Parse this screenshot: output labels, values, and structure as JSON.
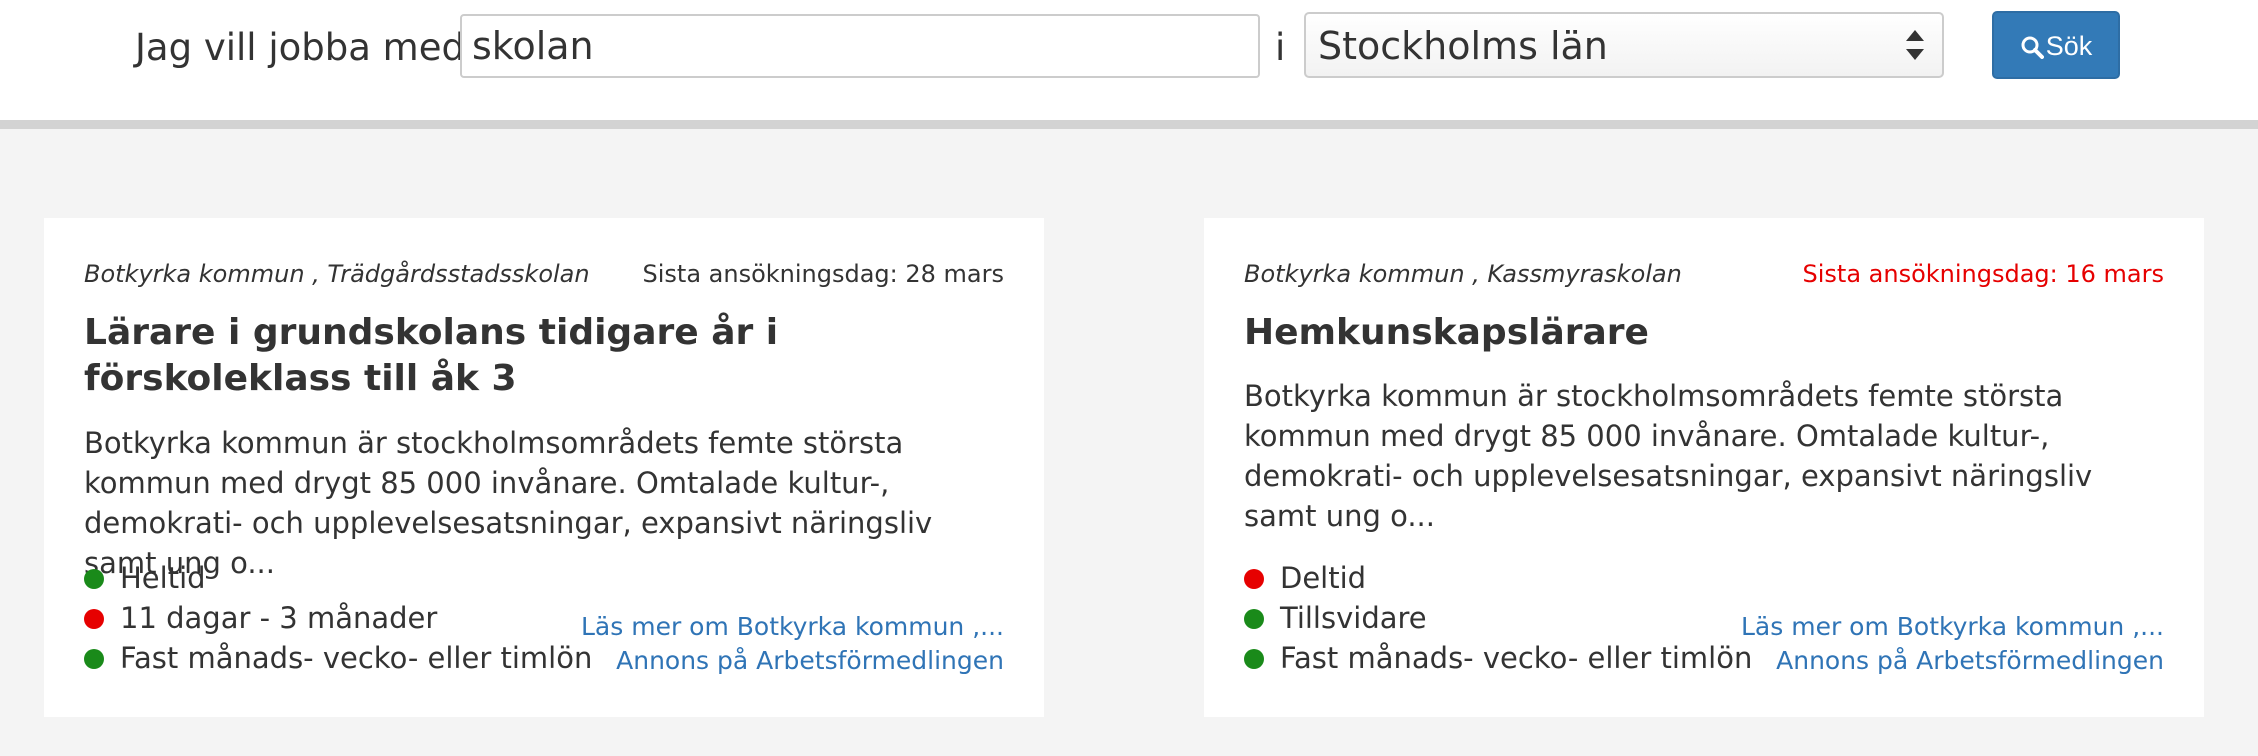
{
  "search": {
    "label": "Jag vill jobba med",
    "query": "skolan",
    "in_label": "i",
    "county": "Stockholms län",
    "button_label": "Sök"
  },
  "colors": {
    "accent": "#337ab7",
    "link": "#2f74b6",
    "status_green": "#1a8a1a",
    "status_red": "#e60000"
  },
  "jobs": [
    {
      "employer": "Botkyrka kommun , Trädgårdsstadsskolan",
      "deadline": "Sista ansökningsdag: 28 mars",
      "deadline_urgent": false,
      "title": "Lärare i grundskolans tidigare år i förskoleklass till åk 3",
      "description": "Botkyrka kommun är stockholmsområdets femte största kommun med drygt 85 000 invånare. Omtalade kultur-, demokrati- och upplevelsesatsningar, expansivt näringsliv samt ung o...",
      "tags": [
        {
          "label": "Heltid",
          "status": "green"
        },
        {
          "label": "11 dagar - 3 månader",
          "status": "red"
        },
        {
          "label": "Fast månads- vecko- eller timlön",
          "status": "green"
        }
      ],
      "link_employer": "Läs mer om Botkyrka kommun ,...",
      "link_ad": "Annons på Arbetsförmedlingen"
    },
    {
      "employer": "Botkyrka kommun , Kassmyraskolan",
      "deadline": "Sista ansökningsdag: 16 mars",
      "deadline_urgent": true,
      "title": "Hemkunskapslärare",
      "description": "Botkyrka kommun är stockholmsområdets femte största kommun med drygt 85 000 invånare. Omtalade kultur-, demokrati- och upplevelsesatsningar, expansivt näringsliv samt ung o...",
      "tags": [
        {
          "label": "Deltid",
          "status": "red"
        },
        {
          "label": "Tillsvidare",
          "status": "green"
        },
        {
          "label": "Fast månads- vecko- eller timlön",
          "status": "green"
        }
      ],
      "link_employer": "Läs mer om Botkyrka kommun ,...",
      "link_ad": "Annons på Arbetsförmedlingen"
    }
  ]
}
